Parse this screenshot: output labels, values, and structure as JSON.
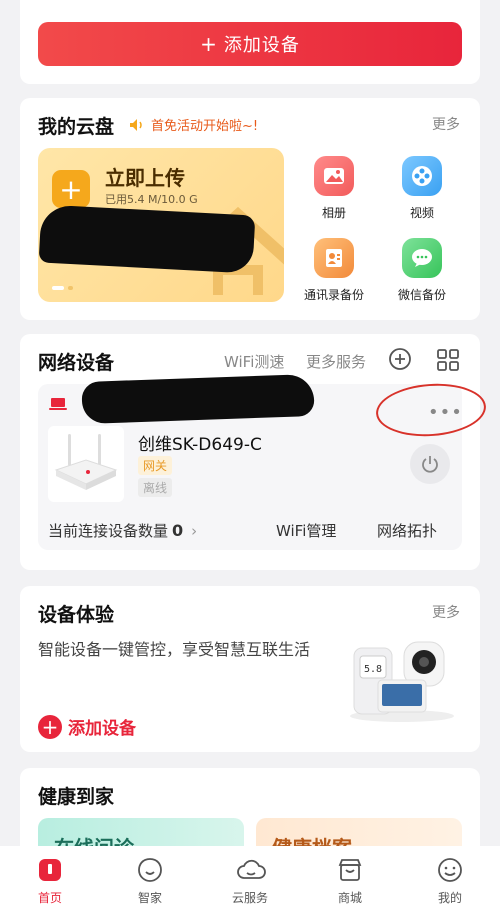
{
  "top": {
    "add_device_label": "添加设备"
  },
  "cloud": {
    "title": "我的云盘",
    "promo": "首免活动开始啦~!",
    "more": "更多",
    "upload_title": "立即上传",
    "upload_used": "已用5.4 M/10.0 G",
    "features": [
      {
        "label": "相册",
        "icon": "photo-album-icon",
        "color": "#f25b5b"
      },
      {
        "label": "视频",
        "icon": "video-reel-icon",
        "color": "#3aa1f2"
      },
      {
        "label": "通讯录备份",
        "icon": "contacts-backup-icon",
        "color": "#f28a3a"
      },
      {
        "label": "微信备份",
        "icon": "wechat-backup-icon",
        "color": "#37c45a"
      }
    ]
  },
  "network": {
    "title": "网络设备",
    "wifi_test": "WiFi测速",
    "more_services": "更多服务",
    "device_name": "创维SK-D649-C",
    "tag_gateway": "网关",
    "tag_offline": "离线",
    "connected_label": "当前连接设备数量",
    "connected_count": "0",
    "wifi_manage": "WiFi管理",
    "topology": "网络拓扑"
  },
  "experience": {
    "title": "设备体验",
    "more": "更多",
    "desc": "智能设备一键管控，享受智慧互联生活",
    "add_label": "添加设备"
  },
  "health": {
    "title": "健康到家",
    "card1": "在线问诊",
    "card2": "健康档案"
  },
  "nav": [
    {
      "label": "首页",
      "icon": "home-icon"
    },
    {
      "label": "智家",
      "icon": "smart-home-icon"
    },
    {
      "label": "云服务",
      "icon": "cloud-icon"
    },
    {
      "label": "商城",
      "icon": "store-icon"
    },
    {
      "label": "我的",
      "icon": "profile-icon"
    }
  ],
  "colors": {
    "brand_red": "#e8253b",
    "promo_orange": "#e85a1a",
    "annotation_red": "#d8322a"
  }
}
